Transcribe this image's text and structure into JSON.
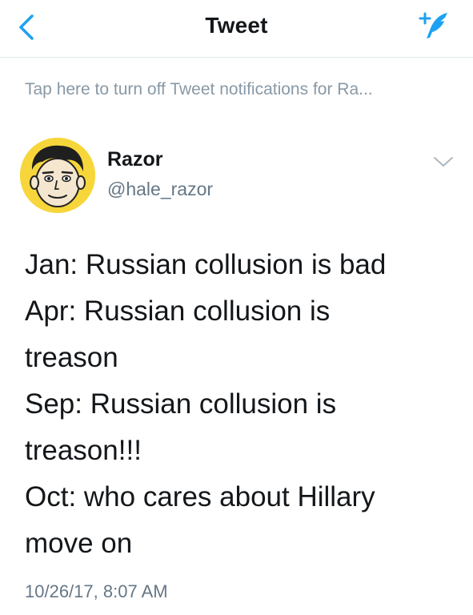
{
  "nav": {
    "title": "Tweet",
    "back_icon": "chevron-left-icon",
    "compose_icon": "compose-tweet-icon",
    "accent_color": "#1da1f2"
  },
  "notification_bar": {
    "text": "Tap here to turn off Tweet notifications for Ra..."
  },
  "tweet": {
    "author": {
      "display_name": "Razor",
      "username": "@hale_razor",
      "avatar": "cartoon-avatar"
    },
    "lines": [
      "Jan: Russian collusion is bad",
      "Apr: Russian collusion is",
      "treason",
      "Sep: Russian collusion is",
      "treason!!!",
      "Oct: who cares about Hillary",
      "move on"
    ],
    "timestamp": "10/26/17, 8:07 AM",
    "menu_icon": "chevron-down-icon"
  }
}
